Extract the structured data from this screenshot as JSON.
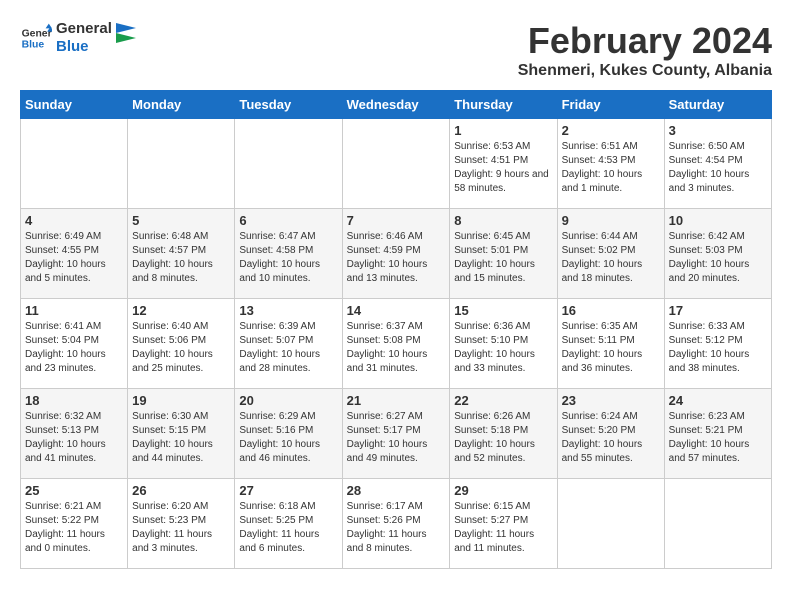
{
  "logo": {
    "line1": "General",
    "line2": "Blue"
  },
  "title": "February 2024",
  "subtitle": "Shenmeri, Kukes County, Albania",
  "days_of_week": [
    "Sunday",
    "Monday",
    "Tuesday",
    "Wednesday",
    "Thursday",
    "Friday",
    "Saturday"
  ],
  "weeks": [
    [
      {
        "day": "",
        "info": ""
      },
      {
        "day": "",
        "info": ""
      },
      {
        "day": "",
        "info": ""
      },
      {
        "day": "",
        "info": ""
      },
      {
        "day": "1",
        "info": "Sunrise: 6:53 AM\nSunset: 4:51 PM\nDaylight: 9 hours and 58 minutes."
      },
      {
        "day": "2",
        "info": "Sunrise: 6:51 AM\nSunset: 4:53 PM\nDaylight: 10 hours and 1 minute."
      },
      {
        "day": "3",
        "info": "Sunrise: 6:50 AM\nSunset: 4:54 PM\nDaylight: 10 hours and 3 minutes."
      }
    ],
    [
      {
        "day": "4",
        "info": "Sunrise: 6:49 AM\nSunset: 4:55 PM\nDaylight: 10 hours and 5 minutes."
      },
      {
        "day": "5",
        "info": "Sunrise: 6:48 AM\nSunset: 4:57 PM\nDaylight: 10 hours and 8 minutes."
      },
      {
        "day": "6",
        "info": "Sunrise: 6:47 AM\nSunset: 4:58 PM\nDaylight: 10 hours and 10 minutes."
      },
      {
        "day": "7",
        "info": "Sunrise: 6:46 AM\nSunset: 4:59 PM\nDaylight: 10 hours and 13 minutes."
      },
      {
        "day": "8",
        "info": "Sunrise: 6:45 AM\nSunset: 5:01 PM\nDaylight: 10 hours and 15 minutes."
      },
      {
        "day": "9",
        "info": "Sunrise: 6:44 AM\nSunset: 5:02 PM\nDaylight: 10 hours and 18 minutes."
      },
      {
        "day": "10",
        "info": "Sunrise: 6:42 AM\nSunset: 5:03 PM\nDaylight: 10 hours and 20 minutes."
      }
    ],
    [
      {
        "day": "11",
        "info": "Sunrise: 6:41 AM\nSunset: 5:04 PM\nDaylight: 10 hours and 23 minutes."
      },
      {
        "day": "12",
        "info": "Sunrise: 6:40 AM\nSunset: 5:06 PM\nDaylight: 10 hours and 25 minutes."
      },
      {
        "day": "13",
        "info": "Sunrise: 6:39 AM\nSunset: 5:07 PM\nDaylight: 10 hours and 28 minutes."
      },
      {
        "day": "14",
        "info": "Sunrise: 6:37 AM\nSunset: 5:08 PM\nDaylight: 10 hours and 31 minutes."
      },
      {
        "day": "15",
        "info": "Sunrise: 6:36 AM\nSunset: 5:10 PM\nDaylight: 10 hours and 33 minutes."
      },
      {
        "day": "16",
        "info": "Sunrise: 6:35 AM\nSunset: 5:11 PM\nDaylight: 10 hours and 36 minutes."
      },
      {
        "day": "17",
        "info": "Sunrise: 6:33 AM\nSunset: 5:12 PM\nDaylight: 10 hours and 38 minutes."
      }
    ],
    [
      {
        "day": "18",
        "info": "Sunrise: 6:32 AM\nSunset: 5:13 PM\nDaylight: 10 hours and 41 minutes."
      },
      {
        "day": "19",
        "info": "Sunrise: 6:30 AM\nSunset: 5:15 PM\nDaylight: 10 hours and 44 minutes."
      },
      {
        "day": "20",
        "info": "Sunrise: 6:29 AM\nSunset: 5:16 PM\nDaylight: 10 hours and 46 minutes."
      },
      {
        "day": "21",
        "info": "Sunrise: 6:27 AM\nSunset: 5:17 PM\nDaylight: 10 hours and 49 minutes."
      },
      {
        "day": "22",
        "info": "Sunrise: 6:26 AM\nSunset: 5:18 PM\nDaylight: 10 hours and 52 minutes."
      },
      {
        "day": "23",
        "info": "Sunrise: 6:24 AM\nSunset: 5:20 PM\nDaylight: 10 hours and 55 minutes."
      },
      {
        "day": "24",
        "info": "Sunrise: 6:23 AM\nSunset: 5:21 PM\nDaylight: 10 hours and 57 minutes."
      }
    ],
    [
      {
        "day": "25",
        "info": "Sunrise: 6:21 AM\nSunset: 5:22 PM\nDaylight: 11 hours and 0 minutes."
      },
      {
        "day": "26",
        "info": "Sunrise: 6:20 AM\nSunset: 5:23 PM\nDaylight: 11 hours and 3 minutes."
      },
      {
        "day": "27",
        "info": "Sunrise: 6:18 AM\nSunset: 5:25 PM\nDaylight: 11 hours and 6 minutes."
      },
      {
        "day": "28",
        "info": "Sunrise: 6:17 AM\nSunset: 5:26 PM\nDaylight: 11 hours and 8 minutes."
      },
      {
        "day": "29",
        "info": "Sunrise: 6:15 AM\nSunset: 5:27 PM\nDaylight: 11 hours and 11 minutes."
      },
      {
        "day": "",
        "info": ""
      },
      {
        "day": "",
        "info": ""
      }
    ]
  ]
}
